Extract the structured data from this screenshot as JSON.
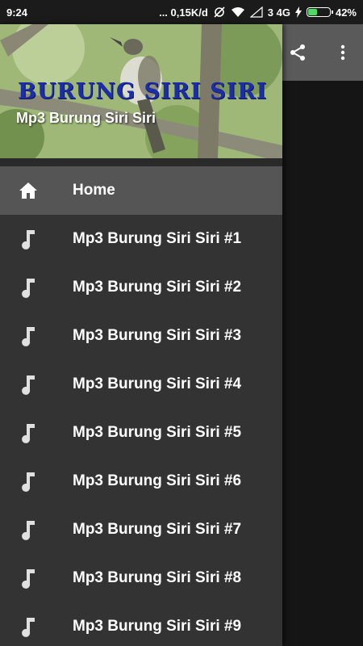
{
  "status_bar": {
    "time": "9:24",
    "network_speed": "... 0,15K/d",
    "network_type": "3 4G",
    "battery": "42%",
    "battery_level": 0.42
  },
  "app_bar": {
    "share_icon": "share-icon",
    "more_icon": "more-vert-icon",
    "color": "#5a5a5a"
  },
  "drawer": {
    "header": {
      "banner_text": "BURUNG SIRI SIRI",
      "subtitle": "Mp3 Burung Siri Siri"
    },
    "items": [
      {
        "label": "Home",
        "icon": "home-icon",
        "active": true
      },
      {
        "label": "Mp3 Burung Siri Siri #1",
        "icon": "music-note-icon"
      },
      {
        "label": "Mp3 Burung Siri Siri #2",
        "icon": "music-note-icon"
      },
      {
        "label": "Mp3 Burung Siri Siri #3",
        "icon": "music-note-icon"
      },
      {
        "label": "Mp3 Burung Siri Siri #4",
        "icon": "music-note-icon"
      },
      {
        "label": "Mp3 Burung Siri Siri #5",
        "icon": "music-note-icon"
      },
      {
        "label": "Mp3 Burung Siri Siri #6",
        "icon": "music-note-icon"
      },
      {
        "label": "Mp3 Burung Siri Siri #7",
        "icon": "music-note-icon"
      },
      {
        "label": "Mp3 Burung Siri Siri #8",
        "icon": "music-note-icon"
      },
      {
        "label": "Mp3 Burung Siri Siri #9",
        "icon": "music-note-icon"
      }
    ],
    "background": "#333333",
    "active_background": "#555555"
  }
}
